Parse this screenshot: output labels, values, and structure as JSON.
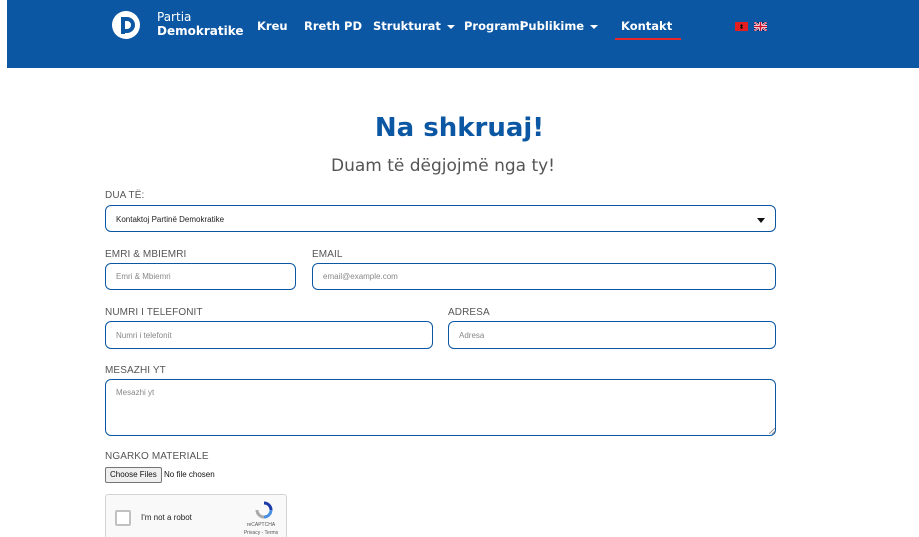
{
  "brand": {
    "line1": "Partia",
    "line2": "Demokratike"
  },
  "nav": {
    "items": [
      {
        "label": "Kreu"
      },
      {
        "label": "Rreth PD"
      },
      {
        "label": "Strukturat"
      },
      {
        "label": "Programi"
      },
      {
        "label": "Publikime"
      },
      {
        "label": "Kontakt"
      }
    ],
    "active": "Kontakt"
  },
  "colors": {
    "brand_blue": "#0b57a3",
    "active_underline": "#e8262b"
  },
  "icons": [
    "pd-logo-icon",
    "albania-flag-icon",
    "uk-flag-icon",
    "chevron-down-icon",
    "recaptcha-icon"
  ],
  "page": {
    "title": "Na shkruaj!",
    "subtitle": "Duam të dëgjojmë nga ty!"
  },
  "form": {
    "purpose": {
      "label": "DUA TË:",
      "value": "Kontaktoj Partinë Demokratike"
    },
    "name": {
      "label": "EMRI & MBIEMRI",
      "placeholder": "Emri & Mbiemri"
    },
    "email": {
      "label": "EMAIL",
      "placeholder": "email@example.com"
    },
    "phone": {
      "label": "NUMRI I TELEFONIT",
      "placeholder": "Numri i telefonit"
    },
    "address": {
      "label": "ADRESA",
      "placeholder": "Adresa"
    },
    "message": {
      "label": "MESAZHI YT",
      "placeholder": "Mesazhi yt"
    },
    "upload": {
      "label": "NGARKO MATERIALE",
      "button": "Choose Files",
      "status": "No file chosen"
    },
    "captcha": {
      "label": "I'm not a robot",
      "brand": "reCAPTCHA",
      "links": "Privacy - Terms"
    }
  }
}
